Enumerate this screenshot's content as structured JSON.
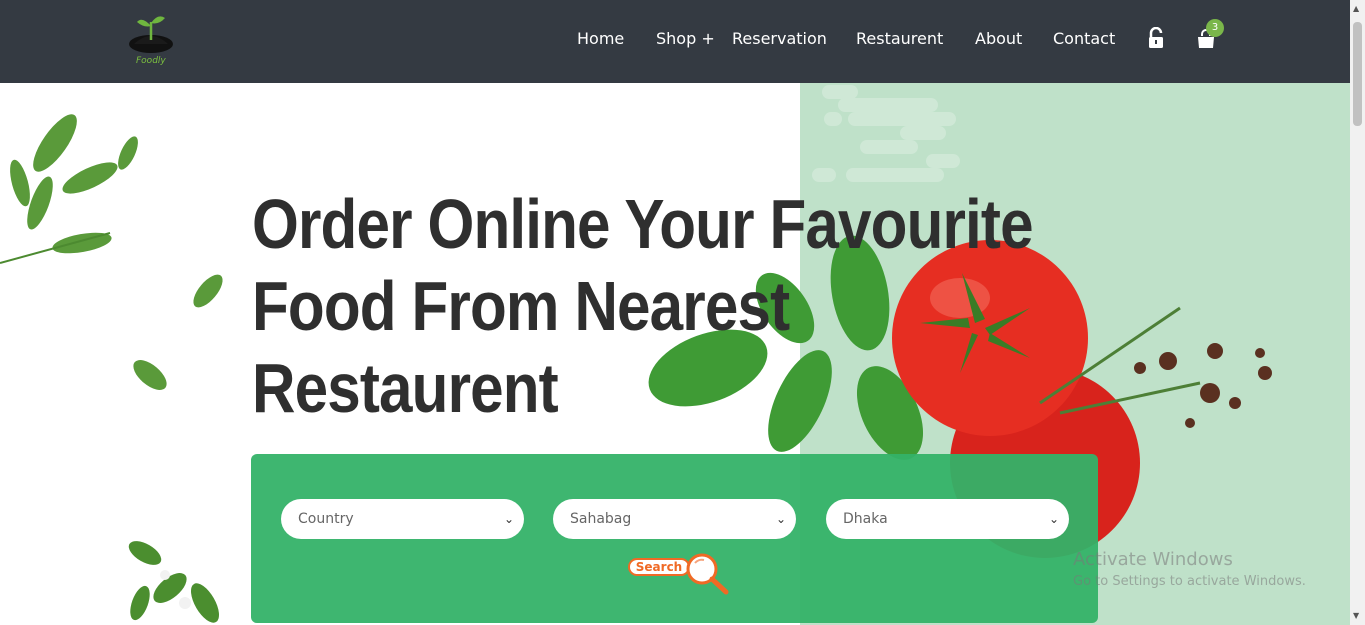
{
  "brand": {
    "name": "Foodly"
  },
  "nav": {
    "items": [
      {
        "label": "Home"
      },
      {
        "label": "Shop +"
      },
      {
        "label": "Reservation"
      },
      {
        "label": "Restaurent"
      },
      {
        "label": "About"
      },
      {
        "label": "Contact"
      }
    ],
    "login_icon": "unlock-icon",
    "cart_icon": "shopping-bag-icon",
    "cart_count": "3"
  },
  "hero": {
    "title_lines": [
      "Order Online Your Favourite",
      "Food From Nearest",
      "Restaurent"
    ]
  },
  "search": {
    "country": {
      "value": "Country"
    },
    "area": {
      "value": "Sahabag"
    },
    "city": {
      "value": "Dhaka"
    },
    "button_label": "Search"
  },
  "watermark": {
    "title": "Activate Windows",
    "subtitle": "Go to Settings to activate Windows."
  },
  "colors": {
    "navbar": "#343a42",
    "panel": "#34b268",
    "accent": "#f06a25",
    "badge": "#7ab64a",
    "hero_bg": "#bfe1c9"
  }
}
